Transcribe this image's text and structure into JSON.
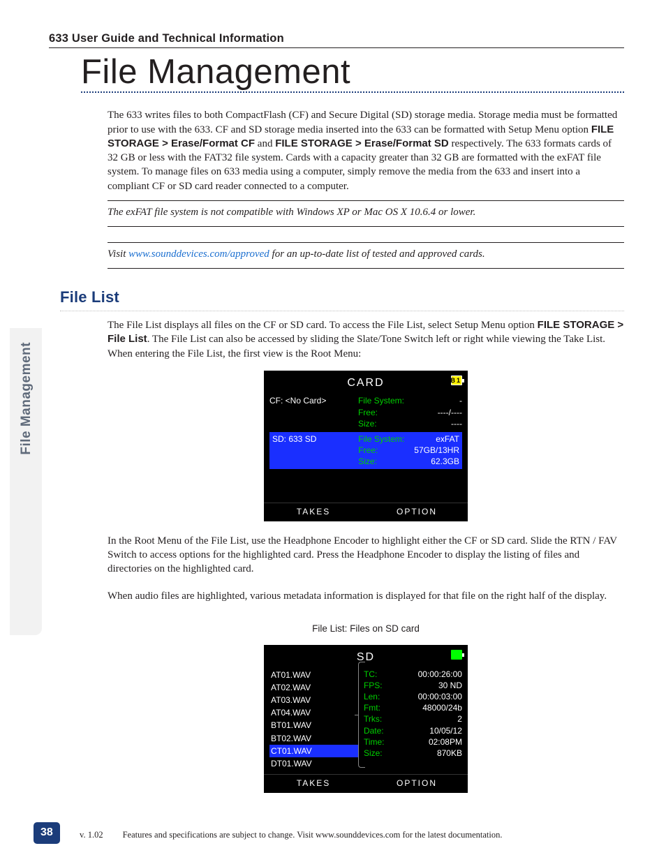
{
  "header": "633 User Guide and Technical Information",
  "chapter_title": "File Management",
  "side_tab": "File Management",
  "page_number": "38",
  "footer": {
    "version": "v. 1.02",
    "text": "Features and specifications are subject to change. Visit www.sounddevices.com for the latest documentation."
  },
  "intro": {
    "p1a": "The 633 writes files to both CompactFlash (CF) and Secure Digital (SD) storage media. Storage media must be formatted prior to use with the 633. CF and SD storage media inserted into the 633 can be formatted with Setup Menu option ",
    "p1b": "FILE STORAGE > Erase/Format CF",
    "p1c": " and ",
    "p1d": "FILE STORAGE > Erase/Format SD",
    "p1e": " respectively. The 633 formats cards of 32 GB or less with the FAT32 file system. Cards with a capacity greater than 32 GB are formatted with the exFAT file system. To manage files on 633 media using a computer, simply remove the media from the 633 and insert into a compliant CF or SD card reader connected to a computer."
  },
  "note1": "The exFAT file system is not compatible with Windows XP or Mac OS X 10.6.4 or lower.",
  "note2": {
    "pre": "Visit ",
    "link_text": "www.sounddevices.com/approved",
    "post": " for an up-to-date list of tested and approved cards."
  },
  "section_title": "File List",
  "filelist_intro": {
    "a": "The File List displays all files on the CF or SD card. To access the File List, select Setup Menu option ",
    "b": "FILE STORAGE > File List",
    "c": ". The File List can also be accessed by sliding the Slate/Tone Switch left or right while viewing the Take List. When entering the File List, the first view is the Root Menu:"
  },
  "lcd1": {
    "title": "CARD",
    "batt_label": "B1",
    "footer_left": "TAKES",
    "footer_right": "OPTION",
    "cf": {
      "name": "CF: <No Card>",
      "fs_label": "File System:",
      "fs_val": "-",
      "free_label": "Free:",
      "free_val": "----/----",
      "size_label": "Size:",
      "size_val": "----"
    },
    "sd": {
      "name": "SD: 633 SD",
      "fs_label": "File System:",
      "fs_val": "exFAT",
      "free_label": "Free:",
      "free_val": "57GB/13HR",
      "size_label": "Size:",
      "size_val": "62.3GB"
    }
  },
  "para_after1": "In the Root Menu of the File List, use the Headphone Encoder to highlight either the CF or SD card. Slide the RTN / FAV Switch to access options for the highlighted card. Press the Headphone Encoder to display the listing of files and directories  on the highlighted card.",
  "para_after2": "When audio files are highlighted, various metadata information is displayed for that file on the right half of the display.",
  "lcd2_caption": "File List: Files on SD card",
  "lcd2": {
    "title": "SD",
    "footer_left": "TAKES",
    "footer_right": "OPTION",
    "files": [
      "AT01.WAV",
      "AT02.WAV",
      "AT03.WAV",
      "AT04.WAV",
      "BT01.WAV",
      "BT02.WAV",
      "CT01.WAV",
      "DT01.WAV"
    ],
    "selected_index": 6,
    "meta": [
      {
        "k": "TC:",
        "v": "00:00:26:00"
      },
      {
        "k": "FPS:",
        "v": "30 ND"
      },
      {
        "k": "Len:",
        "v": "00:00:03:00"
      },
      {
        "k": "Fmt:",
        "v": "48000/24b"
      },
      {
        "k": "Trks:",
        "v": "2"
      },
      {
        "k": "Date:",
        "v": "10/05/12"
      },
      {
        "k": "Time:",
        "v": "02:08PM"
      },
      {
        "k": "Size:",
        "v": "870KB"
      }
    ]
  }
}
